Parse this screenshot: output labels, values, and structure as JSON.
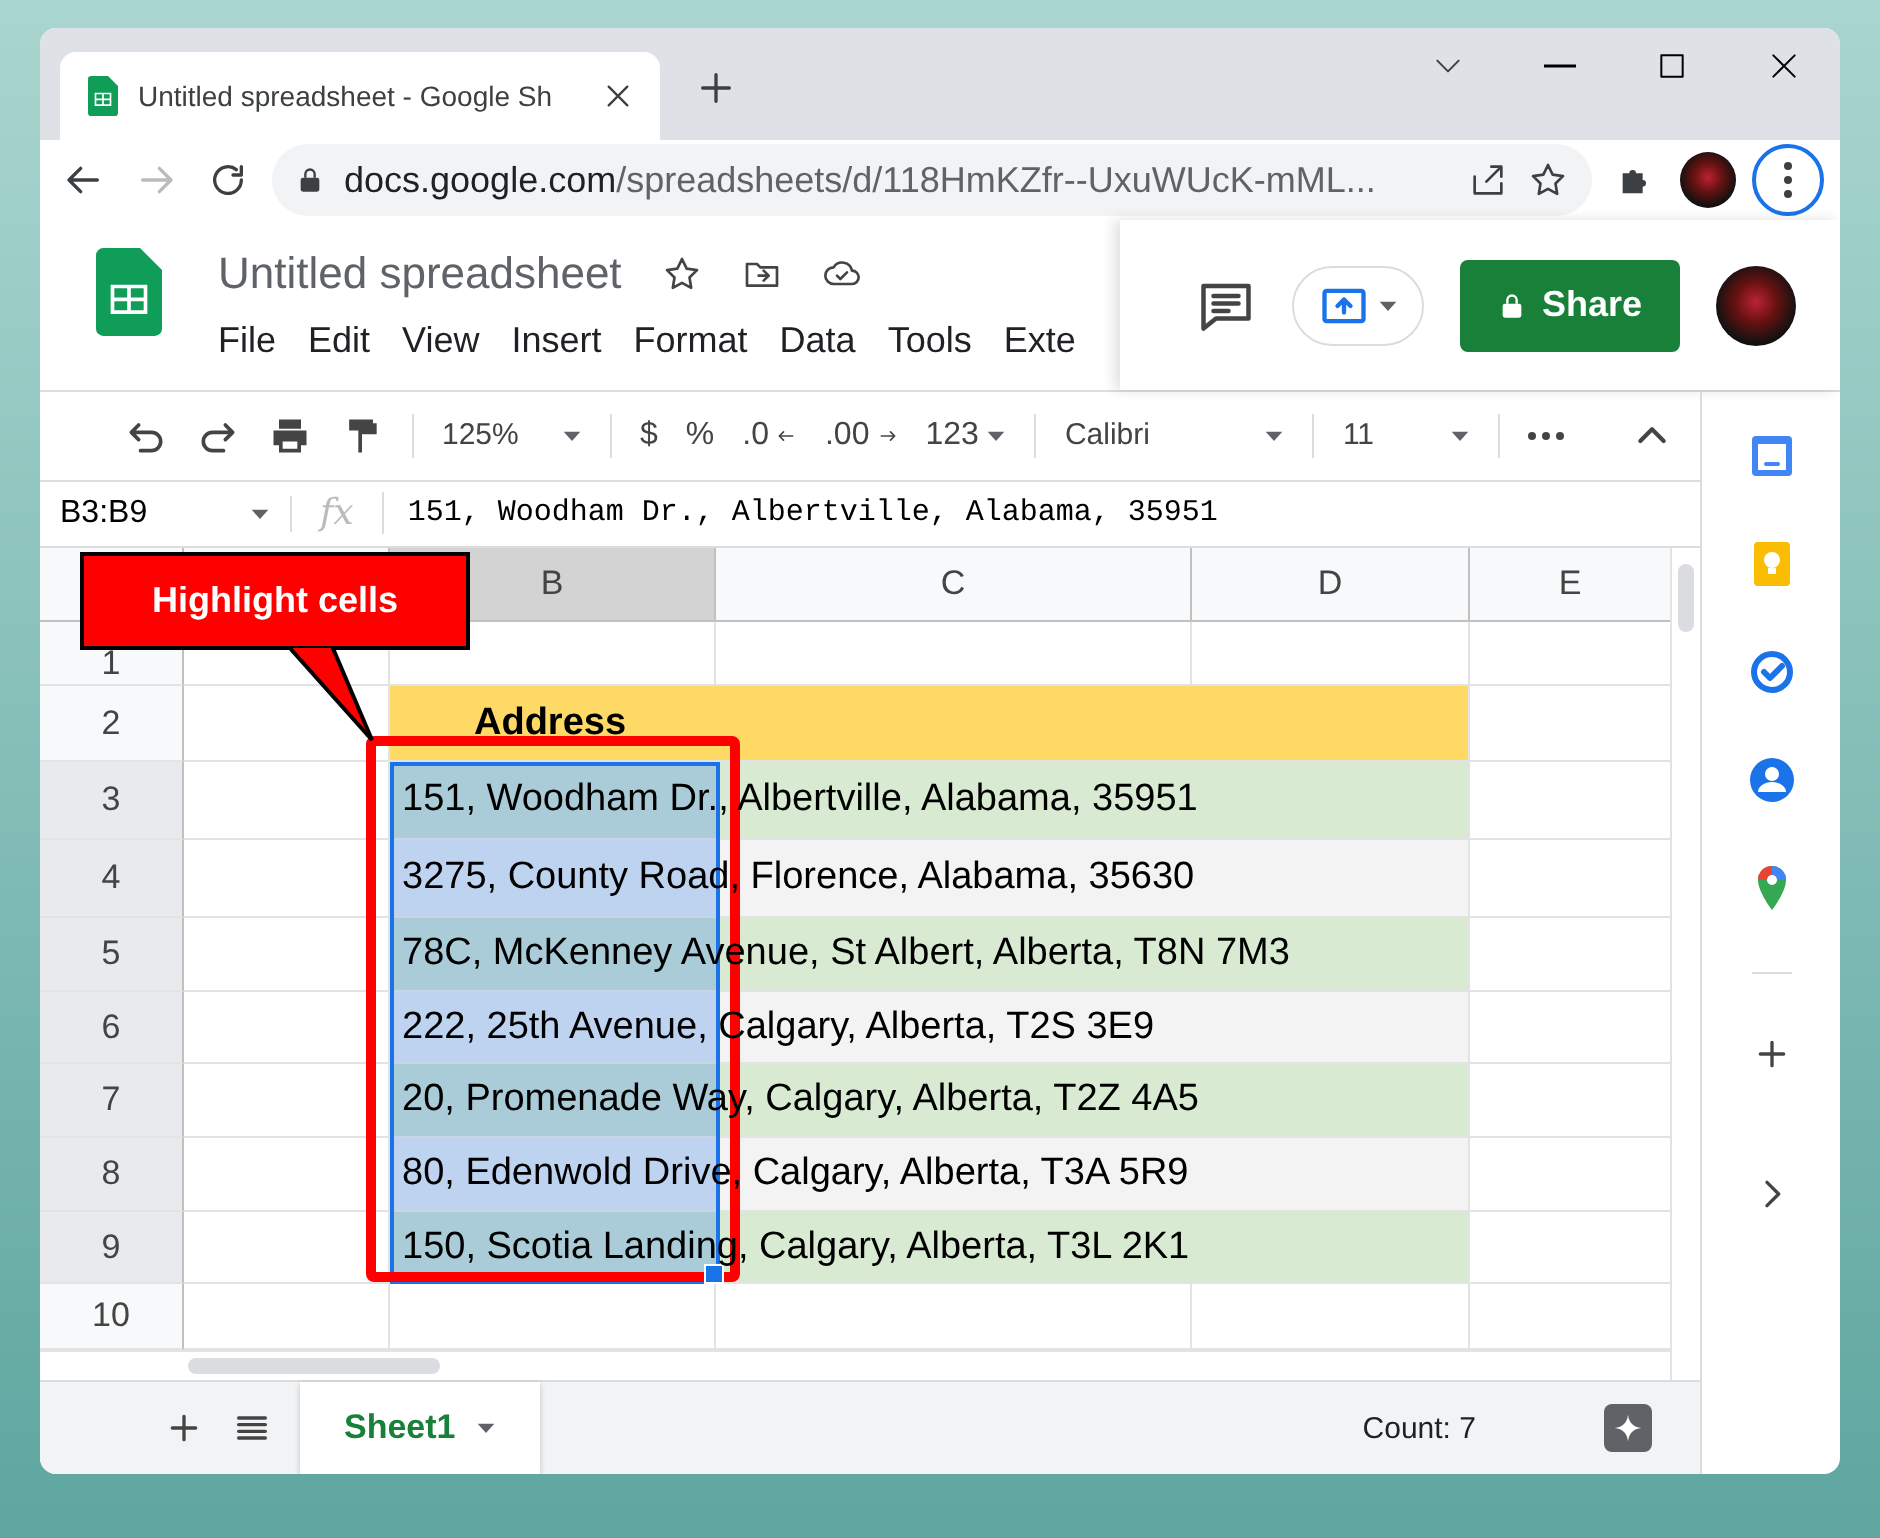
{
  "browser": {
    "tab_title": "Untitled spreadsheet - Google Sh",
    "url_host": "docs.google.com",
    "url_path": "/spreadsheets/d/118HmKZfr--UxuWUcK-mML..."
  },
  "document": {
    "title": "Untitled spreadsheet",
    "menu": [
      "File",
      "Edit",
      "View",
      "Insert",
      "Format",
      "Data",
      "Tools",
      "Exte"
    ],
    "share_button": "Share"
  },
  "toolbar": {
    "zoom": "125%",
    "currency": "$",
    "percent": "%",
    "decrease_decimals": ".0",
    "increase_decimals": ".00",
    "number_format": "123",
    "font": "Calibri",
    "font_size": "11"
  },
  "formula_bar": {
    "name_box": "B3:B9",
    "fx_label": "fx",
    "value": "151, Woodham Dr., Albertville, Alabama, 35951"
  },
  "columns": [
    {
      "label": "B",
      "selected": true
    },
    {
      "label": "C",
      "selected": false
    },
    {
      "label": "D",
      "selected": false
    },
    {
      "label": "E",
      "selected": false
    }
  ],
  "rows": [
    {
      "number": "1",
      "kind": "plain",
      "selected": false,
      "text": ""
    },
    {
      "number": "2",
      "kind": "header",
      "selected": false,
      "text": "Address"
    },
    {
      "number": "3",
      "kind": "green",
      "selected": true,
      "text": "151, Woodham Dr., Albertville, Alabama, 35951"
    },
    {
      "number": "4",
      "kind": "grey",
      "selected": true,
      "text": "3275, County Road, Florence, Alabama, 35630"
    },
    {
      "number": "5",
      "kind": "green",
      "selected": true,
      "text": "78C, McKenney Avenue, St Albert, Alberta, T8N 7M3"
    },
    {
      "number": "6",
      "kind": "grey",
      "selected": true,
      "text": "222, 25th Avenue, Calgary, Alberta, T2S 3E9"
    },
    {
      "number": "7",
      "kind": "green",
      "selected": true,
      "text": "20, Promenade Way, Calgary, Alberta, T2Z 4A5"
    },
    {
      "number": "8",
      "kind": "grey",
      "selected": true,
      "text": "80, Edenwold Drive, Calgary, Alberta, T3A 5R9"
    },
    {
      "number": "9",
      "kind": "green",
      "selected": true,
      "text": "150, Scotia Landing, Calgary, Alberta, T3L 2K1"
    },
    {
      "number": "10",
      "kind": "plain",
      "selected": false,
      "text": ""
    }
  ],
  "callout": "Highlight cells",
  "sheet_tabs": [
    {
      "label": "Sheet1",
      "selected": true
    }
  ],
  "status": "Count: 7"
}
